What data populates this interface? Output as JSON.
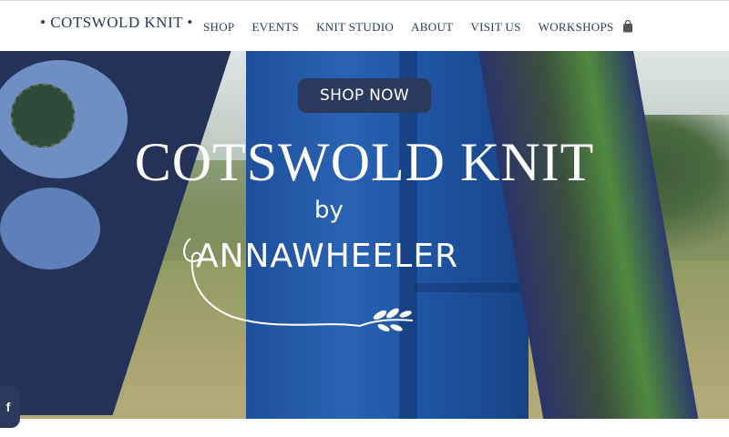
{
  "brand": {
    "logo_text": "• COTSWOLD KNIT •"
  },
  "nav": {
    "items": [
      {
        "label": "SHOP"
      },
      {
        "label": "EVENTS"
      },
      {
        "label": "KNIT STUDIO"
      },
      {
        "label": "ABOUT"
      },
      {
        "label": "VISIT US"
      },
      {
        "label": "WORKSHOPS"
      }
    ],
    "cart_icon": "shopping-bag-icon"
  },
  "hero": {
    "button_label": "SHOP NOW",
    "title": "COTSWOLD KNIT",
    "by": "by",
    "designer": "ANNAWHEELER"
  },
  "social": {
    "facebook_label": "f",
    "icon": "facebook-icon"
  },
  "colors": {
    "navy": "#2b3a5c",
    "white": "#ffffff"
  }
}
